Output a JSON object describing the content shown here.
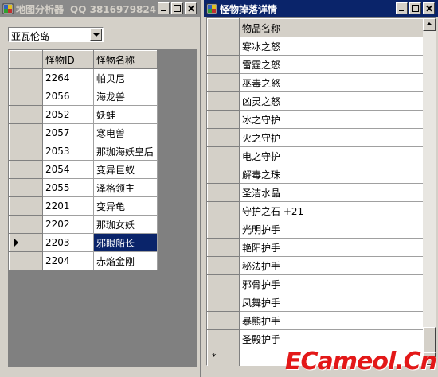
{
  "window1": {
    "title": "地图分析器",
    "qq": "QQ 3816979824",
    "combo_value": "亚瓦伦岛",
    "columns": [
      "怪物ID",
      "怪物名称"
    ],
    "rows": [
      {
        "id": "2264",
        "name": "帕贝尼"
      },
      {
        "id": "2056",
        "name": "海龙兽"
      },
      {
        "id": "2052",
        "name": "妖蛙"
      },
      {
        "id": "2057",
        "name": "寒电兽"
      },
      {
        "id": "2053",
        "name": "那珈海妖皇后"
      },
      {
        "id": "2054",
        "name": "变异巨蚁"
      },
      {
        "id": "2055",
        "name": "泽格领主"
      },
      {
        "id": "2201",
        "name": "变异龟"
      },
      {
        "id": "2202",
        "name": "那珈女妖"
      },
      {
        "id": "2203",
        "name": "邪眼船长"
      },
      {
        "id": "2204",
        "name": "赤焰金刚"
      }
    ],
    "selected_index": 9
  },
  "window2": {
    "title": "怪物掉落详情",
    "column": "物品名称",
    "items": [
      "寒冰之怒",
      "雷霆之怒",
      "巫毒之怒",
      "凶灵之怒",
      "冰之守护",
      "火之守护",
      "电之守护",
      "解毒之珠",
      "圣洁水晶",
      "守护之石 +21",
      "光明护手",
      "艳阳护手",
      "秘法护手",
      "邪骨护手",
      "凤舞护手",
      "暴熊护手",
      "圣殿护手"
    ],
    "new_row_marker": "*"
  },
  "watermark": "ECameol.Cn",
  "colors": {
    "active_title": "#0a246a",
    "inactive_title": "#8a8a8a",
    "selection": "#0a246a",
    "watermark": "#e31818"
  }
}
